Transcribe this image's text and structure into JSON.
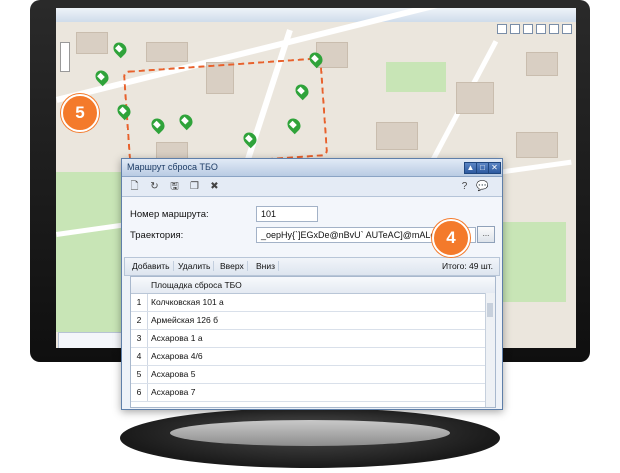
{
  "dialog": {
    "title": "Маршрут сброса ТБО",
    "route_number_label": "Номер маршрута:",
    "route_number_value": "101",
    "trajectory_label": "Траектория:",
    "trajectory_value": "_oepHy{`]EGxDe@nBvU` AUTeAC]@mALe",
    "dots_label": "...",
    "buttons": {
      "add": "Добавить",
      "delete": "Удалить",
      "up": "Вверх",
      "down": "Вниз"
    },
    "total": "Итого: 49 шт.",
    "column_header": "Площадка сброса ТБО",
    "rows": [
      {
        "n": "1",
        "name": "Колчковская 101 а"
      },
      {
        "n": "2",
        "name": "Армейская 126 б"
      },
      {
        "n": "3",
        "name": "Асхарова 1 а"
      },
      {
        "n": "4",
        "name": "Асхарова 4/6"
      },
      {
        "n": "5",
        "name": "Асхарова 5"
      },
      {
        "n": "6",
        "name": "Асхарова 7"
      }
    ]
  },
  "callouts": {
    "five": "5",
    "four": "4"
  },
  "colors": {
    "accent": "#f47a2b",
    "pin": "#2fa33a",
    "route": "#e8612c"
  }
}
